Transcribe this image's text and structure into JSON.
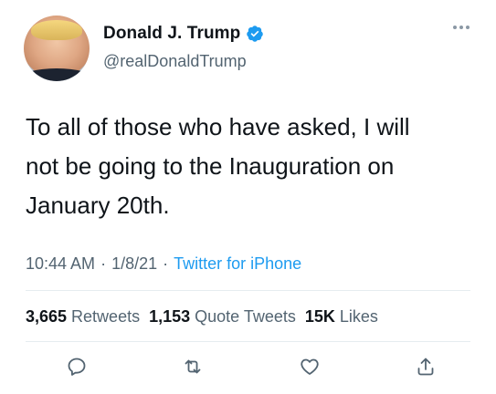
{
  "author": {
    "name": "Donald J. Trump",
    "handle": "@realDonaldTrump",
    "verified": true
  },
  "tweet": {
    "text_line1": "To all of those who have asked, I will",
    "text_line2": "not be going to the Inauguration on",
    "text_line3": "January 20th.",
    "time": "10:44 AM",
    "separator": "·",
    "date": "1/8/21",
    "source": "Twitter for iPhone"
  },
  "stats": {
    "retweets_count": "3,665",
    "retweets_label": "Retweets",
    "quotes_count": "1,153",
    "quotes_label": "Quote Tweets",
    "likes_count": "15K",
    "likes_label": "Likes"
  },
  "icons": {
    "reply": "reply-icon",
    "retweet": "retweet-icon",
    "like": "heart-icon",
    "share": "share-icon",
    "more": "more-icon",
    "verified": "verified-badge-icon"
  },
  "colors": {
    "text": "#0f1419",
    "secondary": "#536471",
    "link": "#1d9bf0",
    "verified": "#1d9bf0"
  }
}
